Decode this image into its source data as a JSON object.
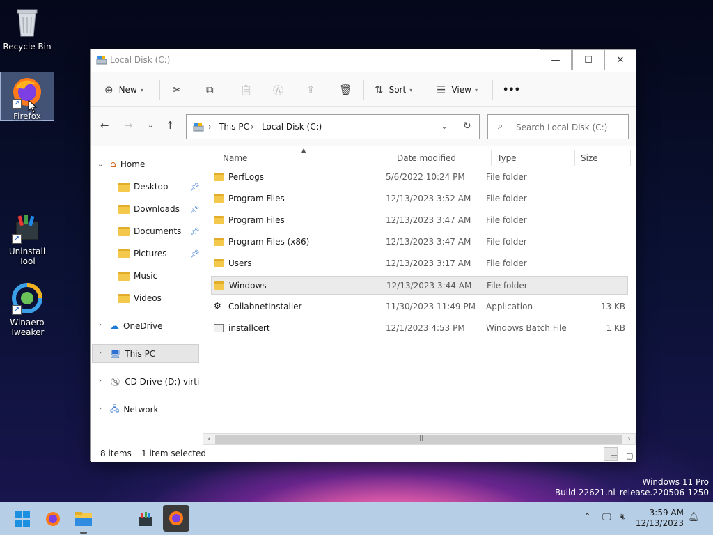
{
  "desktop": {
    "icons": [
      {
        "label": "Recycle Bin"
      },
      {
        "label": "Firefox"
      },
      {
        "label": "Uninstall Tool"
      },
      {
        "label": "Winaero Tweaker"
      }
    ]
  },
  "window": {
    "title": "Local Disk (C:)",
    "controls": {
      "minimize": "—",
      "maximize": "☐",
      "close": "✕"
    }
  },
  "commandbar": {
    "new_label": "New",
    "sort_label": "Sort",
    "view_label": "View",
    "more_label": "•••"
  },
  "address": {
    "crumbs": [
      "This PC",
      "Local Disk (C:)"
    ],
    "search_placeholder": "Search Local Disk (C:)"
  },
  "nav": {
    "home": "Home",
    "quick": [
      "Desktop",
      "Downloads",
      "Documents",
      "Pictures",
      "Music",
      "Videos"
    ],
    "onedrive": "OneDrive",
    "thispc": "This PC",
    "cddrive": "CD Drive (D:) virtio-",
    "network": "Network"
  },
  "columns": {
    "name": "Name",
    "date": "Date modified",
    "type": "Type",
    "size": "Size"
  },
  "files": [
    {
      "name": "PerfLogs",
      "date": "5/6/2022 10:24 PM",
      "type": "File folder",
      "size": "",
      "kind": "folder"
    },
    {
      "name": "Program Files",
      "date": "12/13/2023 3:52 AM",
      "type": "File folder",
      "size": "",
      "kind": "folder"
    },
    {
      "name": "Program Files",
      "date": "12/13/2023 3:47 AM",
      "type": "File folder",
      "size": "",
      "kind": "folder"
    },
    {
      "name": "Program Files (x86)",
      "date": "12/13/2023 3:47 AM",
      "type": "File folder",
      "size": "",
      "kind": "folder"
    },
    {
      "name": "Users",
      "date": "12/13/2023 3:17 AM",
      "type": "File folder",
      "size": "",
      "kind": "folder"
    },
    {
      "name": "Windows",
      "date": "12/13/2023 3:44 AM",
      "type": "File folder",
      "size": "",
      "kind": "folder"
    },
    {
      "name": "CollabnetInstaller",
      "date": "11/30/2023 11:49 PM",
      "type": "Application",
      "size": "13 KB",
      "kind": "app"
    },
    {
      "name": "installcert",
      "date": "12/1/2023 4:53 PM",
      "type": "Windows Batch File",
      "size": "1 KB",
      "kind": "bat"
    }
  ],
  "status": {
    "items": "8 items",
    "selected": "1 item selected"
  },
  "watermark": {
    "line1": "Windows 11 Pro",
    "line2": "Build 22621.ni_release.220506-1250"
  },
  "clock": {
    "time": "3:59 AM",
    "date": "12/13/2023"
  },
  "colors": {
    "accent": "#0067c0",
    "folder": "#f4c84a",
    "taskbar": "#b6cfe7"
  }
}
